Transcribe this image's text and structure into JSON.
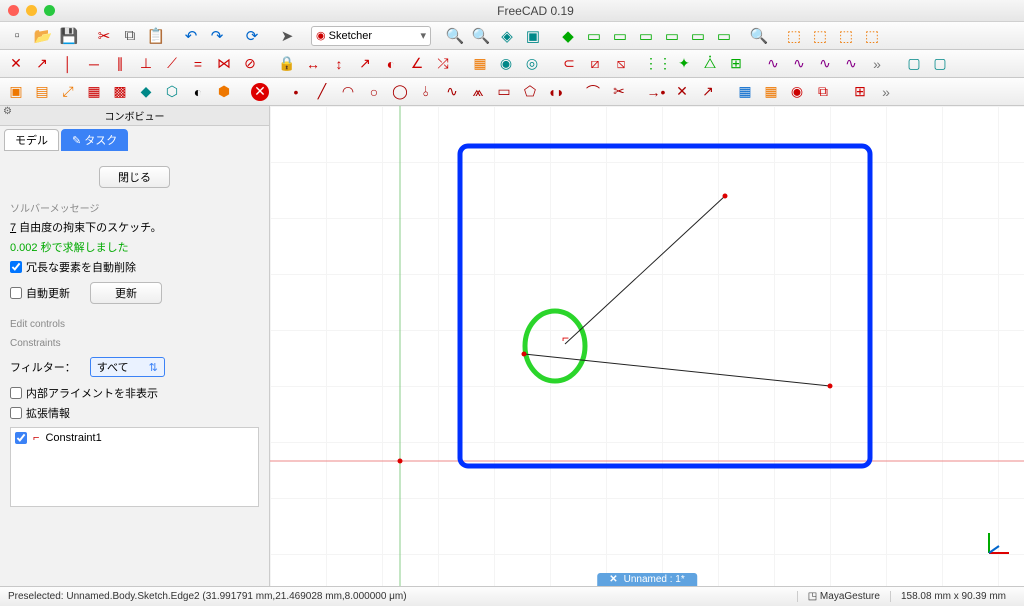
{
  "window": {
    "title": "FreeCAD 0.19"
  },
  "workbench": {
    "selected": "Sketcher"
  },
  "combo": {
    "title": "コンボビュー",
    "tabs": {
      "model": "モデル",
      "task": "タスク"
    },
    "close": "閉じる",
    "solver_hdr": "ソルバーメッセージ",
    "dof_prefix": "7",
    "dof_text": " 自由度の拘束下のスケッチ。",
    "solve_msg": "0.002 秒で求解しました",
    "auto_remove": "冗長な要素を自動削除",
    "auto_update": "自動更新",
    "update_btn": "更新",
    "edit_hdr": "Edit controls",
    "cons_hdr": "Constraints",
    "filter_label": "フィルター：",
    "filter_value": "すべて",
    "hide_align": "内部アライメントを非表示",
    "ext_info": "拡張情報",
    "constraint1": "Constraint1"
  },
  "doc_tab": {
    "name": "Unnamed : 1*"
  },
  "status": {
    "preselect": "Preselected: Unnamed.Body.Sketch.Edge2 (31.991791 mm,21.469028 mm,8.000000 μm)",
    "nav": "MayaGesture",
    "dims": "158.08 mm x 90.39 mm"
  },
  "icons": {
    "row1": [
      "new",
      "open",
      "save",
      "sep",
      "cut",
      "copy",
      "paste",
      "sep",
      "undo",
      "redo",
      "sep",
      "refresh",
      "sep",
      "cursor",
      "sep",
      "WB",
      "sep",
      "zoom-fit",
      "zoom-in",
      "zoom-sel",
      "sep",
      "draw-style",
      "sep",
      "view-iso",
      "view-front",
      "view-top",
      "view-right",
      "view-rear",
      "view-bottom",
      "view-left",
      "sep",
      "measure",
      "sep",
      "isometric",
      "sep",
      "cube1",
      "cube2",
      "cube3",
      "cube4"
    ],
    "row2": [
      "c-coincident",
      "c-point",
      "c-vertical",
      "c-horizontal",
      "c-perp",
      "c-parallel",
      "c-tangent",
      "c-equal",
      "c-symm",
      "c-block",
      "sep",
      "c-lock",
      "c-hdist",
      "c-vdist",
      "c-dist",
      "c-radius",
      "c-angle",
      "c-snell",
      "sep",
      "pd-pad",
      "pd-pocket",
      "pd-rev",
      "pd-loft",
      "sep",
      "pd-fillet",
      "pd-chamfer",
      "pd-draft",
      "pd-thick",
      "sep",
      "pd-linear",
      "pd-polar",
      "pd-mirror",
      "pd-multi",
      "sep",
      "more1",
      "more2",
      "sep",
      "skt1",
      "skt2"
    ],
    "row3": [
      "sk-new",
      "sk-edit",
      "sk-leave",
      "sk-view",
      "sk-map",
      "sk-validate",
      "sk-merge",
      "sk-mirror",
      "sep",
      "stop",
      "sep",
      "sk-point",
      "sk-line",
      "sk-arc",
      "sk-circle",
      "sk-ellipse",
      "sk-polyline",
      "sk-rect",
      "sk-poly",
      "sk-slot",
      "sep",
      "sk-bspline",
      "sk-point2",
      "sep",
      "sk-fillet",
      "sk-trim",
      "sk-extend",
      "sk-split",
      "sep",
      "sk-ext",
      "sk-carbon",
      "sep",
      "sk-construct",
      "sep",
      "sk-clone",
      "sk-copy"
    ]
  }
}
